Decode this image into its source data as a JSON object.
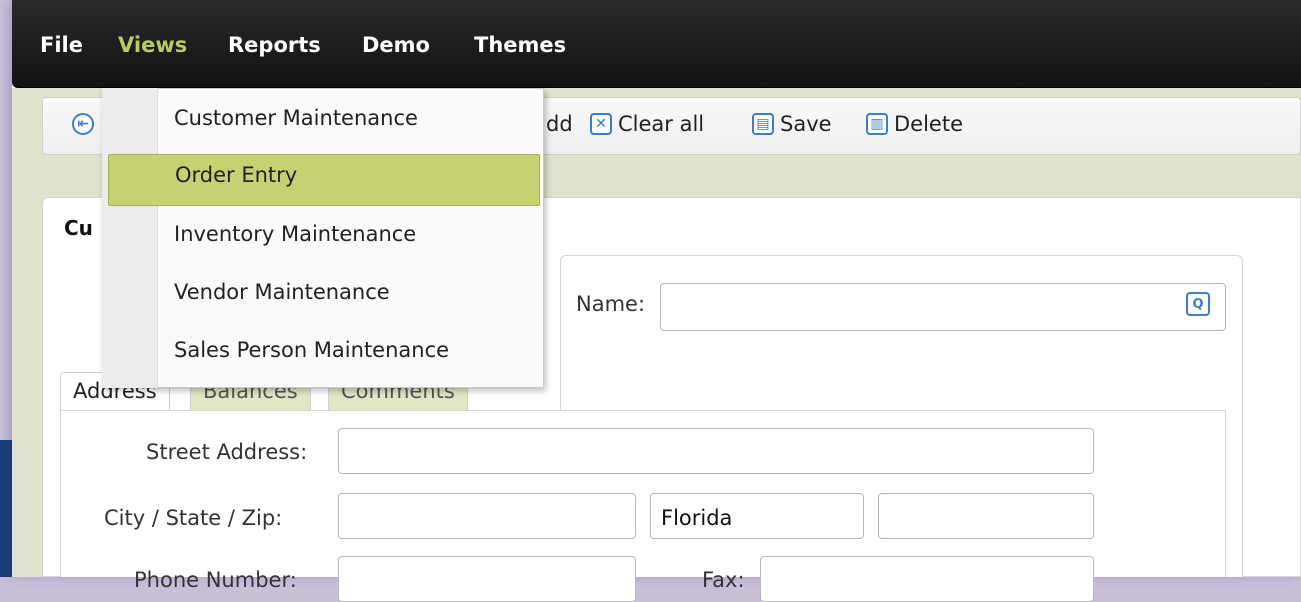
{
  "menubar": {
    "items": [
      {
        "label": "File"
      },
      {
        "label": "Views",
        "active": true
      },
      {
        "label": "Reports"
      },
      {
        "label": "Demo"
      },
      {
        "label": "Themes"
      }
    ]
  },
  "toolbar": {
    "first_icon": "first-record-icon",
    "add_label_visible": "dd",
    "clear_label": "Clear all",
    "save_label": "Save",
    "delete_label": "Delete",
    "clear_icon": "clear-icon",
    "save_icon": "save-icon",
    "delete_icon": "trash-icon"
  },
  "views_menu": {
    "items": [
      {
        "label": "Customer Maintenance"
      },
      {
        "label": "Order Entry",
        "highlighted": true
      },
      {
        "label": "Inventory Maintenance"
      },
      {
        "label": "Vendor Maintenance"
      },
      {
        "label": "Sales Person Maintenance"
      }
    ]
  },
  "panel": {
    "title_visible": "Cu",
    "name_label": "Name:",
    "name_value": ""
  },
  "tabs": [
    {
      "label": "Address",
      "active": true
    },
    {
      "label": "Balances"
    },
    {
      "label": "Comments"
    }
  ],
  "address": {
    "street_label": "Street Address:",
    "street_value": "",
    "city_state_zip_label": "City / State / Zip:",
    "city_value": "",
    "state_value": "Florida",
    "zip_value": "",
    "phone_label": "Phone Number:",
    "fax_label": "Fax:"
  },
  "colors": {
    "menubar_bg": "#1b1b1b",
    "active_menu": "#b7cc62",
    "highlight": "#c7d172",
    "accent": "#3a7ec6"
  }
}
